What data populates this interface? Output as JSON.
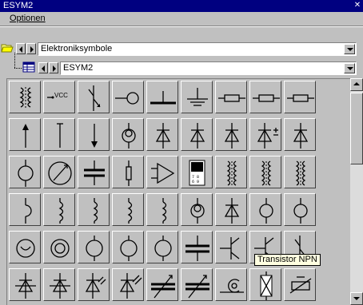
{
  "window": {
    "title": "ESYM2"
  },
  "menu": {
    "options_label": "Optionen"
  },
  "library_combo": {
    "value": "Elektroniksymbole"
  },
  "file_combo": {
    "value": "ESYM2"
  },
  "tooltip": {
    "text": "Transistor NPN"
  },
  "symbols": {
    "vcc_label": "VCC"
  },
  "grid": {
    "rows": 6,
    "columns": 10,
    "cell_names": [
      [
        "inductor-core",
        "vcc-supply",
        "transistor",
        "signal-source",
        "ground-bar",
        "earth-ground",
        "resistor",
        "resistor",
        "resistor"
      ],
      [
        "arrow-up",
        "wire-vertical",
        "arrow-down",
        "current-source",
        "diode",
        "diode",
        "diode",
        "zener-diode",
        "diode"
      ],
      [
        "lamp",
        "meter",
        "capacitor",
        "fuse",
        "amplifier",
        "ic-chip",
        "transformer",
        "transformer",
        "transformer"
      ],
      [
        "coil-half",
        "inductor",
        "inductor",
        "inductor",
        "inductor",
        "current-source",
        "diode",
        "lamp-small",
        "lamp-small"
      ],
      [
        "voltmeter",
        "ammeter",
        "lamp-variant",
        "lamp-variant",
        "lamp-variant",
        "capacitor-large",
        "transistor-npn",
        "transistor-npn",
        "transistor"
      ],
      [
        "thyristor",
        "thyristor",
        "photodiode",
        "led",
        "variable-capacitor",
        "variable-capacitor",
        "coax-plug",
        "crystal",
        "thermistor"
      ]
    ]
  }
}
